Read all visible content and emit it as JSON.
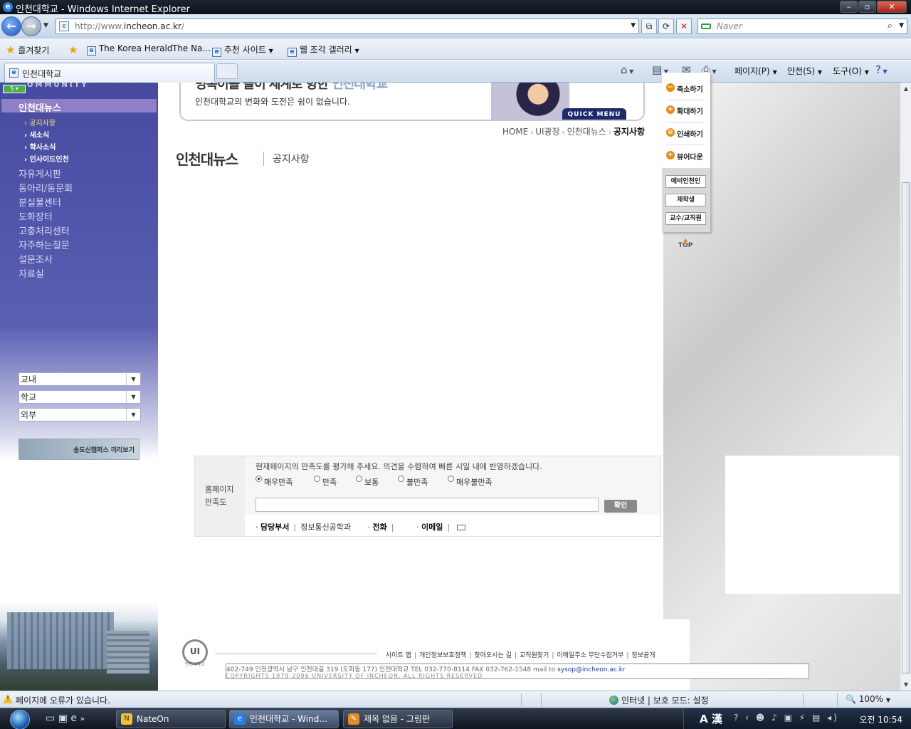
{
  "browser": {
    "window_title": "인천대학교 - Windows Internet Explorer",
    "url_prefix": "http://www.",
    "url_domain": "incheon.ac.kr",
    "url_suffix": "/",
    "search_placeholder": "Naver",
    "favorites_label": "즐겨찾기",
    "favorite_links": [
      "The Korea Herald",
      "The Na...",
      "추천 사이트",
      "웹 조각 갤러리"
    ],
    "tab_title": "인천대학교",
    "commands": [
      "페이지(P)",
      "안전(S)",
      "도구(O)"
    ]
  },
  "sidebar": {
    "community_label": "OMMUNITY",
    "active_section": "인천대뉴스",
    "sub_items": [
      "공지사항",
      "새소식",
      "학사소식",
      "인사이드인천"
    ],
    "items": [
      "자유게시판",
      "동아리/동문회",
      "분실물센터",
      "도화장터",
      "고충처리센터",
      "자주하는질문",
      "설문조사",
      "자료실"
    ],
    "selects": [
      "교내",
      "학교",
      "외부"
    ],
    "campus_banner": "송도신캠퍼스 미리보기"
  },
  "banner": {
    "slogan": "명목이를 놀이 세계로 향한",
    "slogan_highlight": "인천대학교",
    "description": "인천대학교의 변화와 도전은 쉼이 없습니다.",
    "quick_menu": "QUICK MENU"
  },
  "breadcrumb": [
    "HOME",
    "UI광장",
    "인천대뉴스",
    "공지사항"
  ],
  "page": {
    "title": "인천대뉴스",
    "subtitle": "공지사항"
  },
  "quick_menu": {
    "actions": [
      "축소하기",
      "확대하기",
      "인쇄하기",
      "뷰어다운"
    ],
    "buttons": [
      "예비인천인",
      "재학생",
      "교수/교직원"
    ],
    "top_label": "TOP"
  },
  "survey": {
    "heading_line1": "홈페이지",
    "heading_line2": "만족도",
    "question": "현재페이지의 만족도를 평가해 주세요. 의견을 수렴하여 빠른 시일 내에 반영하겠습니다.",
    "options": [
      "매우만족",
      "만족",
      "보통",
      "불만족",
      "매우불만족"
    ],
    "selected_option": "매우만족",
    "submit_label": "확인",
    "dept_label": "담당부서",
    "dept_value": "정보통신공학과",
    "phone_label": "전화",
    "email_label": "이메일"
  },
  "footer": {
    "logo_text": "인천대학교",
    "links": [
      "사이트 맵",
      "개인정보보호정책",
      "찾아오시는 길",
      "교직원찾기",
      "이메일주소 무단수집거부",
      "정보공개"
    ],
    "address": "402-749 인천광역시 남구 인천대길 319 (도화동 177) 인천대학교   TEL 032-770-8114   FAX 032-762-1548   mail to",
    "email": "sysop@incheon.ac.kr",
    "copyright": "COPYRIGHTS 1979-2006  UNIVERSITY OF INCHEON.  ALL RIGHTS RESERVED"
  },
  "status_bar": {
    "message": "페이지에 오류가 있습니다.",
    "zone": "인터넷 | 보호 모드: 설정",
    "zoom": "100%"
  },
  "taskbar": {
    "tasks": [
      "NateOn",
      "인천대학교 - Wind...",
      "제목 없음 - 그림판"
    ],
    "ime_label": "A 漢",
    "clock": "오전 10:54"
  },
  "colors": {
    "sidebar_top": "#474a9f",
    "sidebar_active": "#8d80c6",
    "quick_dot": "#ea8a12",
    "title_bar": "#1c2633"
  }
}
